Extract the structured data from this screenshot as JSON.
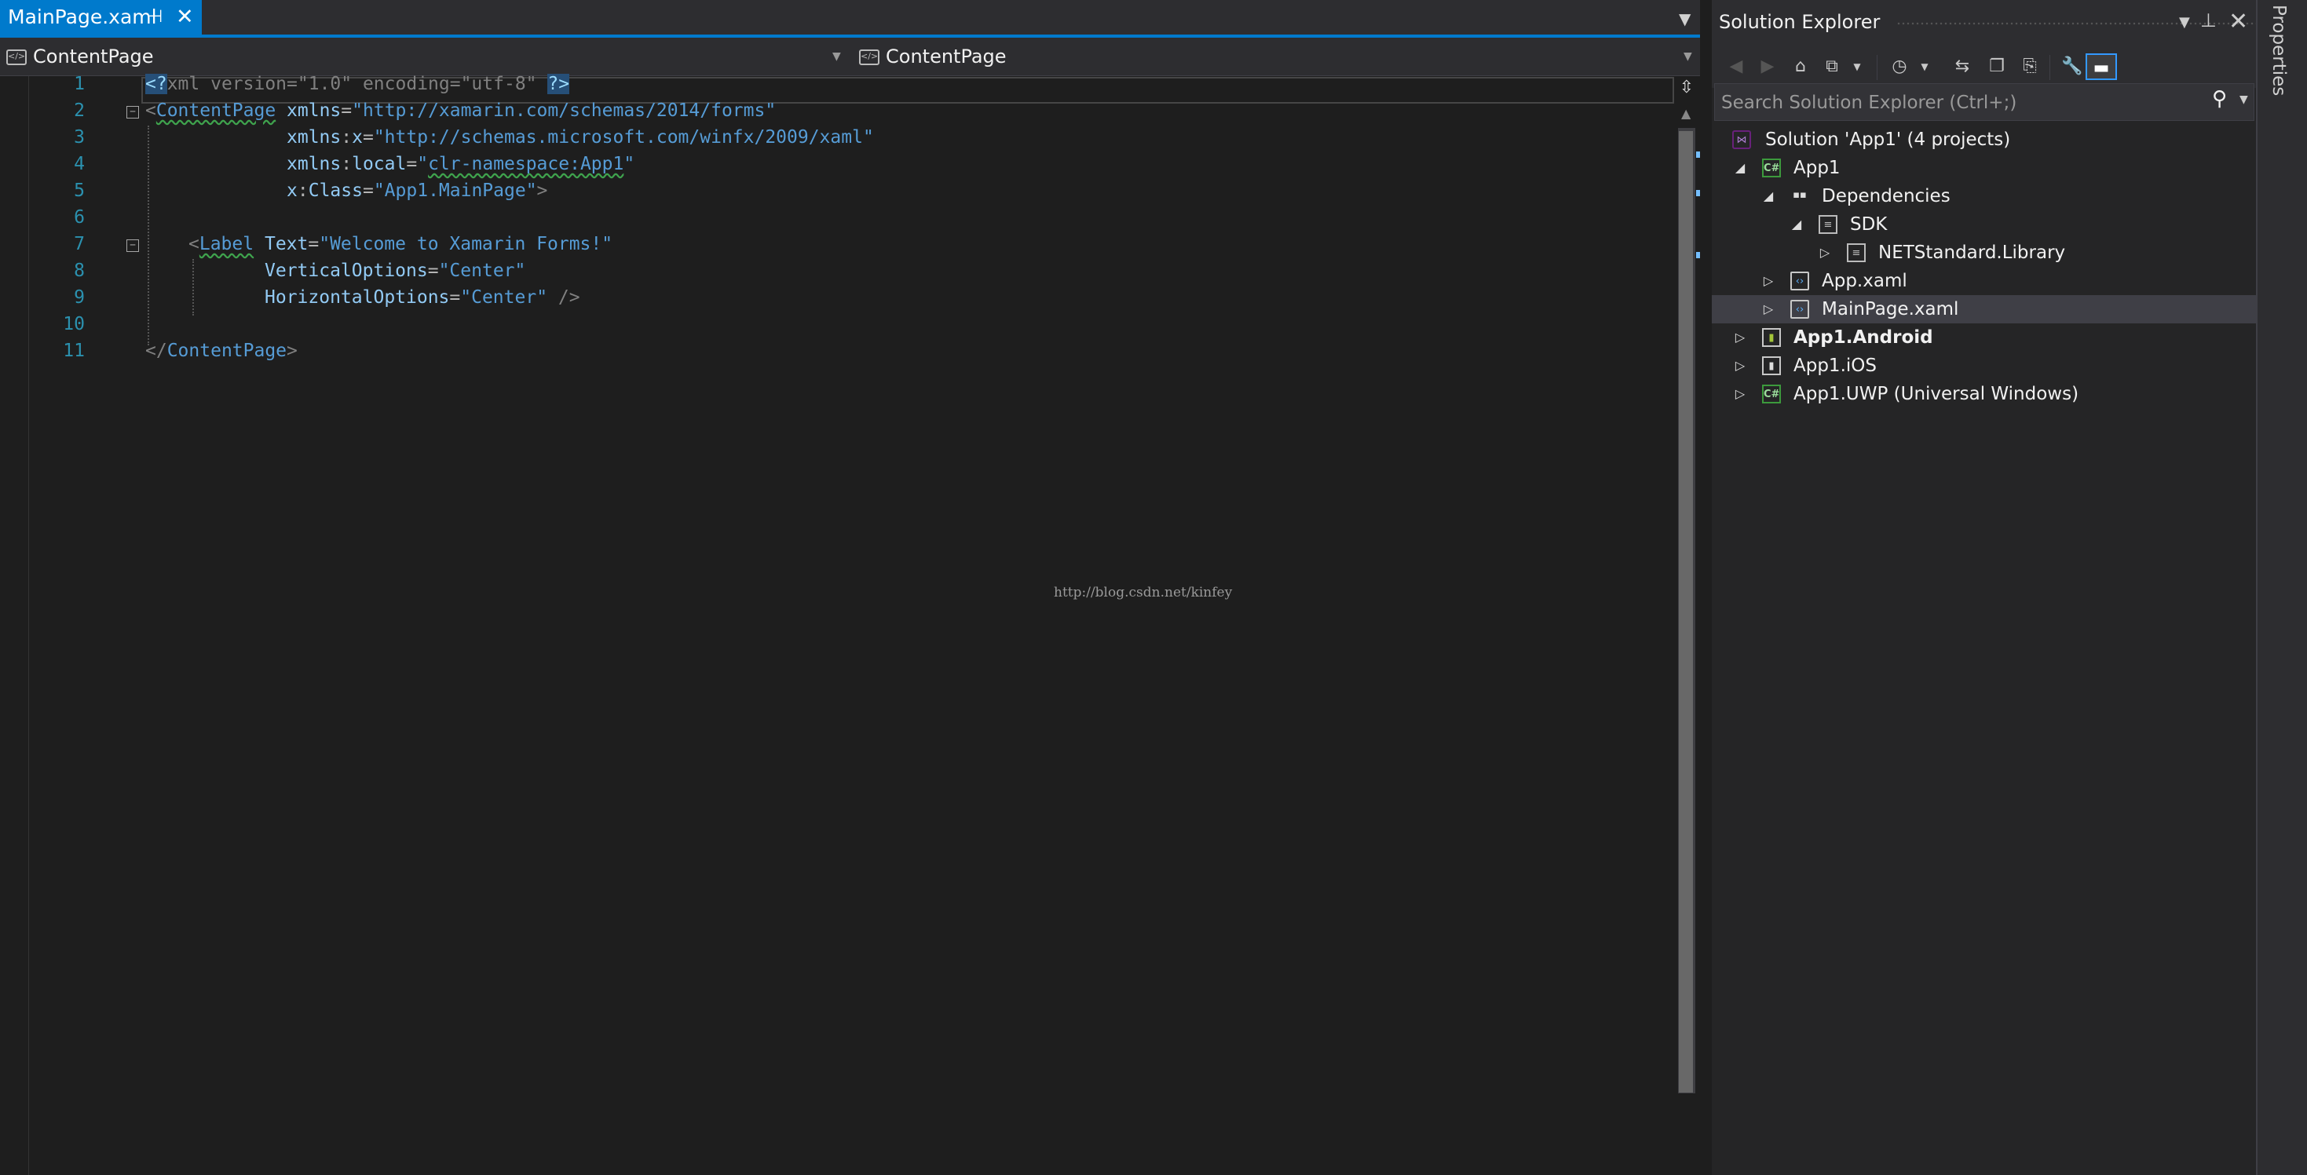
{
  "tab": {
    "title": "MainPage.xaml"
  },
  "navbar": {
    "left": "ContentPage",
    "right": "ContentPage"
  },
  "editor": {
    "line_numbers": [
      "1",
      "2",
      "3",
      "4",
      "5",
      "6",
      "7",
      "8",
      "9",
      "10",
      "11"
    ],
    "line1": {
      "pi_open": "<?",
      "body": "xml version=\"1.0\" encoding=\"utf-8\" ",
      "pi_close": "?>"
    },
    "line2": {
      "open": "<",
      "tag": "ContentPage",
      "attr": "xmlns",
      "eq": "=",
      "val": "\"http://xamarin.com/schemas/2014/forms\""
    },
    "line3": {
      "prefix": "xmlns",
      "colon": ":",
      "attr": "x",
      "eq": "=",
      "val": "\"http://schemas.microsoft.com/winfx/2009/xaml\""
    },
    "line4": {
      "prefix": "xmlns",
      "colon": ":",
      "attr": "local",
      "eq": "=",
      "q": "\"",
      "val": "clr-namespace:App1",
      "q2": "\""
    },
    "line5": {
      "prefix": "x",
      "colon": ":",
      "attr": "Class",
      "eq": "=",
      "val": "\"App1.MainPage\"",
      "close": ">"
    },
    "line7": {
      "open": "<",
      "tag": "Label",
      "attr": "Text",
      "eq": "=",
      "val": "\"Welcome to Xamarin Forms!\""
    },
    "line8": {
      "attr": "VerticalOptions",
      "eq": "=",
      "val": "\"Center\""
    },
    "line9": {
      "attr": "HorizontalOptions",
      "eq": "=",
      "val": "\"Center\"",
      "close": " />"
    },
    "line11": {
      "open": "</",
      "tag": "ContentPage",
      "close": ">"
    }
  },
  "watermark": "http://blog.csdn.net/kinfey",
  "solution_explorer": {
    "title": "Solution Explorer",
    "search_placeholder": "Search Solution Explorer (Ctrl+;)",
    "tree": [
      {
        "label": "Solution 'App1' (4 projects)",
        "icon": "solution-icon"
      },
      {
        "label": "App1",
        "icon": "csharp-project-icon"
      },
      {
        "label": "Dependencies",
        "icon": "dependencies-icon"
      },
      {
        "label": "SDK",
        "icon": "sdk-icon"
      },
      {
        "label": "NETStandard.Library",
        "icon": "package-icon"
      },
      {
        "label": "App.xaml",
        "icon": "xaml-file-icon"
      },
      {
        "label": "MainPage.xaml",
        "icon": "xaml-file-icon"
      },
      {
        "label": "App1.Android",
        "icon": "android-project-icon"
      },
      {
        "label": "App1.iOS",
        "icon": "ios-project-icon"
      },
      {
        "label": "App1.UWP (Universal Windows)",
        "icon": "csharp-project-icon"
      }
    ]
  },
  "properties_tab": "Properties",
  "colors": {
    "accent": "#007acc",
    "background": "#1e1e1e",
    "panel": "#252526",
    "selection_row": "#3f3f46"
  }
}
